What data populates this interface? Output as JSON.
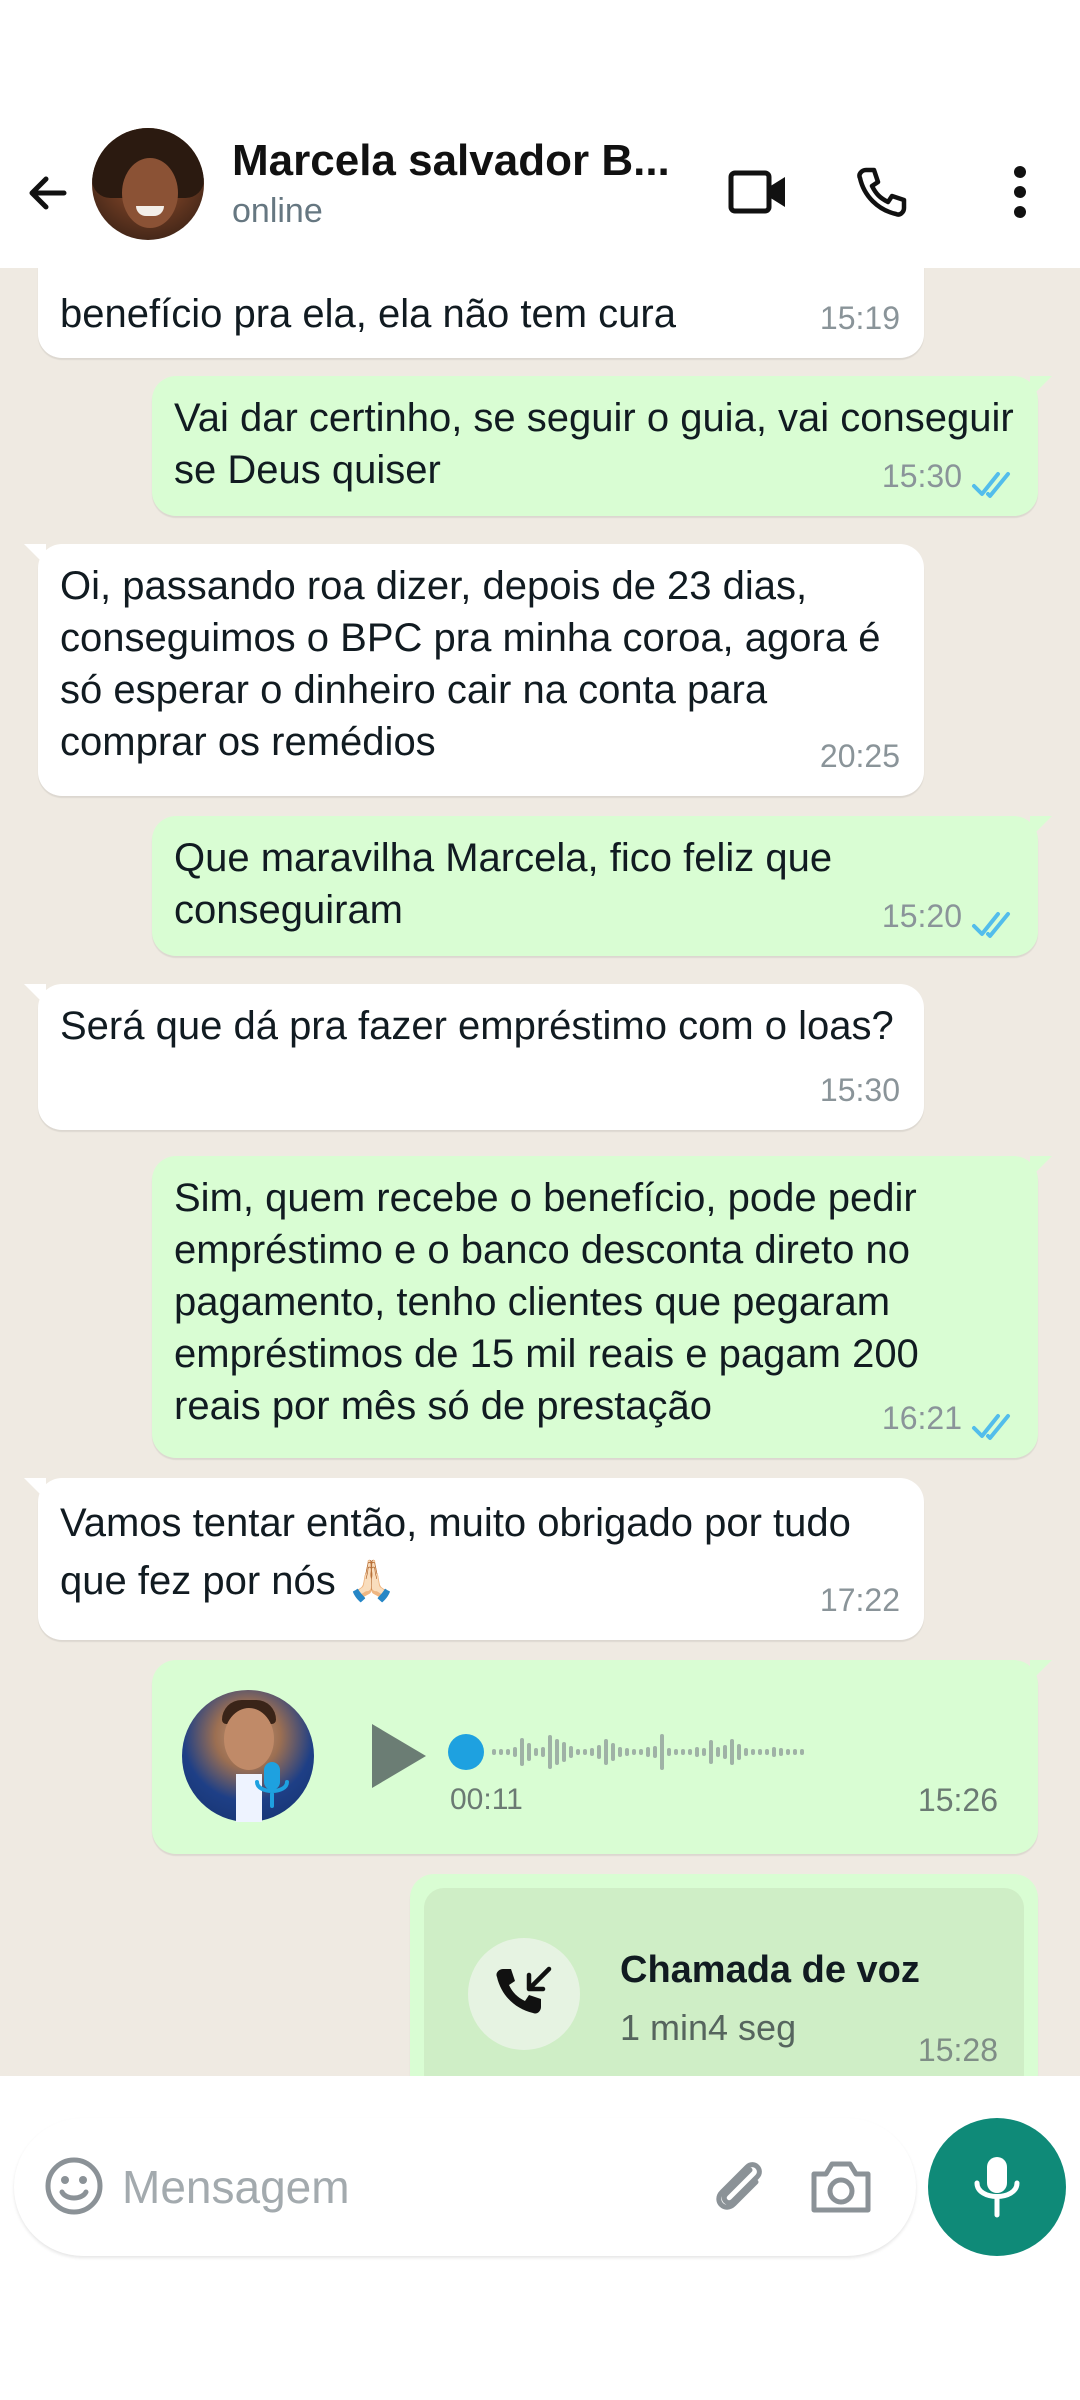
{
  "header": {
    "contact_name": "Marcela salvador B...",
    "contact_status": "online"
  },
  "messages": [
    {
      "direction": "in",
      "text": "benefício pra ela, ela não tem cura",
      "time": "15:19"
    },
    {
      "direction": "out",
      "text": "Vai dar certinho, se seguir o guia, vai conseguir se Deus quiser",
      "time": "15:30",
      "status": "read"
    },
    {
      "direction": "in",
      "text": "Oi, passando roa dizer, depois de 23 dias, conseguimos o BPC pra minha coroa, agora é só esperar o dinheiro cair na conta para comprar os remédios",
      "time": "20:25"
    },
    {
      "direction": "out",
      "text": "Que maravilha Marcela, fico feliz que conseguiram",
      "time": "15:20",
      "status": "read"
    },
    {
      "direction": "in",
      "text": "Será que dá pra fazer empréstimo com o loas?",
      "time": "15:30"
    },
    {
      "direction": "out",
      "text": "Sim, quem recebe o benefício, pode pedir empréstimo e o banco desconta direto no pagamento, tenho clientes que pegaram empréstimos de 15 mil reais e pagam 200 reais por mês só de prestação",
      "time": "16:21",
      "status": "read"
    },
    {
      "direction": "in",
      "text": "Vamos tentar então, muito obrigado por tudo que fez por nós 🙏🏻",
      "time": "17:22"
    }
  ],
  "voice_message": {
    "duration": "00:11",
    "time": "15:26",
    "progress": 0
  },
  "call": {
    "title": "Chamada de voz",
    "duration": "1 min4 seg",
    "time": "15:28"
  },
  "composer": {
    "placeholder": "Mensagem"
  },
  "colors": {
    "chat_background": "#efeae2",
    "incoming_bubble": "#ffffff",
    "outgoing_bubble": "#d9fdd3",
    "read_ticks": "#53bdeb",
    "accent": "#0f8a78"
  }
}
